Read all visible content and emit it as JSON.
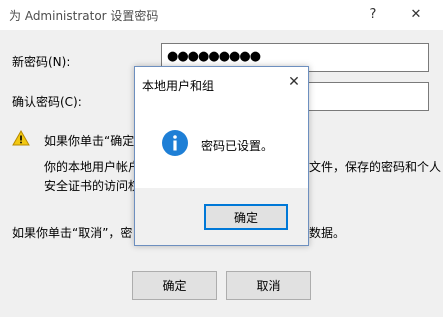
{
  "window": {
    "title": "为 Administrator 设置密码",
    "help_glyph": "?",
    "close_glyph": "✕"
  },
  "form": {
    "new_password_label": "新密码(N):",
    "new_password_value": "●●●●●●●●●",
    "confirm_password_label": "确认密码(C):",
    "confirm_password_value": ""
  },
  "warning": {
    "icon": "warning-icon",
    "line1": "如果你单击“确定",
    "line2_left": "你的本地用户帐户",
    "line2_right": "文件，保存的密码和个人",
    "line3": "安全证书的访问权",
    "cancel_left": "如果你单击“取消”，密",
    "cancel_right": "数据。"
  },
  "buttons": {
    "ok": "确定",
    "cancel": "取消"
  },
  "message_box": {
    "title": "本地用户和组",
    "close_glyph": "✕",
    "icon": "info-icon",
    "text": "密码已设置。",
    "ok": "确定"
  },
  "colors": {
    "accent": "#0078d7",
    "warning": "#f2c811",
    "info": "#1e7fd6"
  }
}
